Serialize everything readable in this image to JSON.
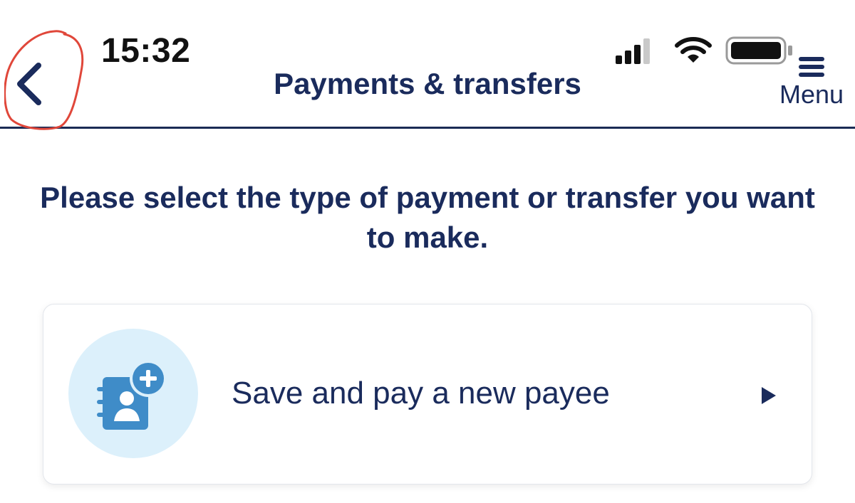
{
  "status_bar": {
    "time": "15:32",
    "icons": [
      "signal-icon",
      "wifi-icon",
      "battery-icon"
    ]
  },
  "nav": {
    "back_icon": "chevron-left-icon",
    "title": "Payments & transfers",
    "menu_icon": "hamburger-icon",
    "menu_label": "Menu"
  },
  "main": {
    "instructions": "Please select the type of payment or transfer you want to make.",
    "options": [
      {
        "icon": "add-contact-icon",
        "label": "Save and pay a new payee",
        "chevron_icon": "triangle-right-icon"
      }
    ]
  },
  "colors": {
    "primary": "#1a2b5c",
    "icon_blue": "#3f8cc8",
    "icon_bg": "#dcf0fb",
    "annotation_red": "#e0473a"
  }
}
